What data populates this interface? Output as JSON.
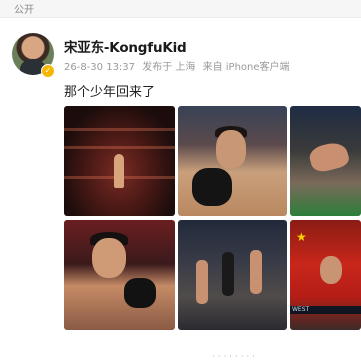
{
  "header": {
    "visibility": "公开"
  },
  "post": {
    "author": {
      "name": "宋亚东-KongfuKid",
      "verified_icon": "verified-badge-icon"
    },
    "meta": {
      "timestamp": "26-8-30 13:37",
      "published_location": "发布于 上海",
      "source": "来自 iPhone客户端"
    },
    "text": "那个少年回来了",
    "photos": [
      {
        "label": "photo-1"
      },
      {
        "label": "photo-2"
      },
      {
        "label": "photo-3"
      },
      {
        "label": "photo-4"
      },
      {
        "label": "photo-5"
      },
      {
        "label": "photo-6"
      }
    ],
    "photo_overlay_text": "WEST"
  },
  "footer": {
    "partial_text": "· · ·  · · ·  · ·"
  }
}
